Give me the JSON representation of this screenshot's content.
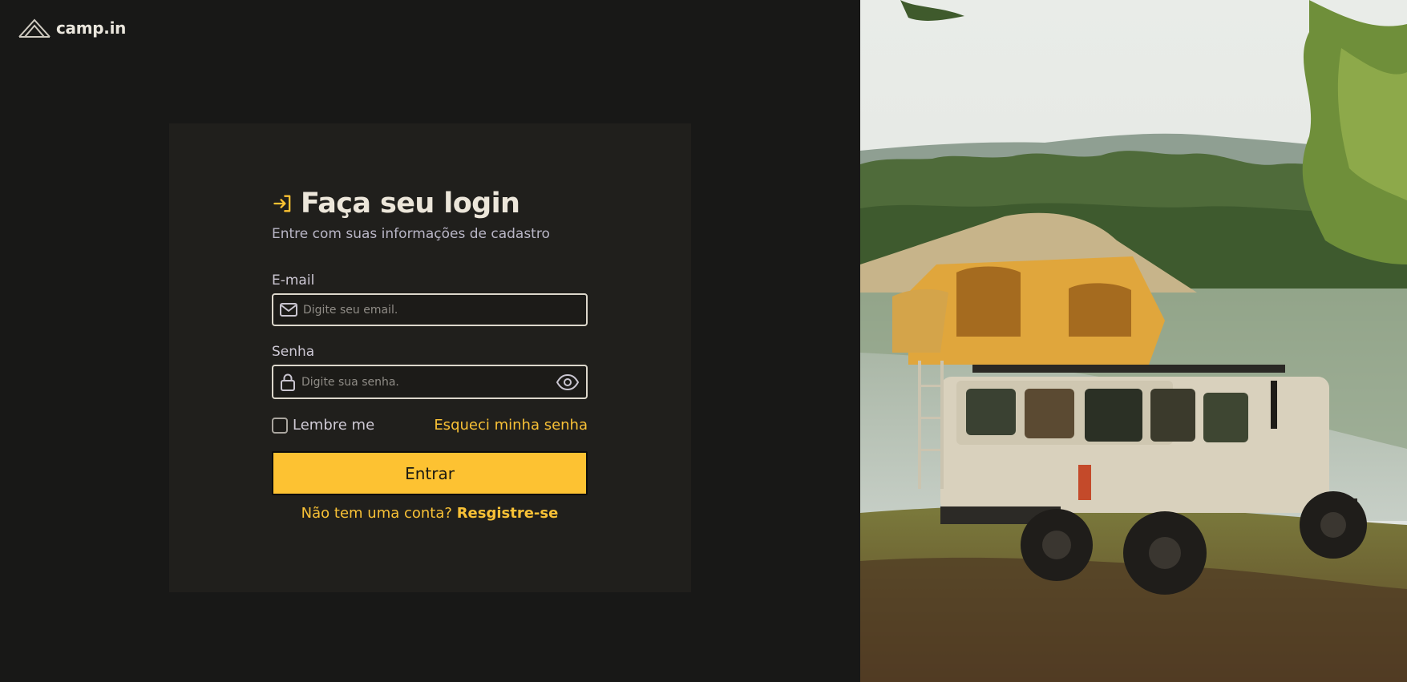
{
  "brand": {
    "name": "camp.in"
  },
  "login": {
    "title": "Faça seu login",
    "subtitle": "Entre com suas informações de cadastro",
    "email_label": "E-mail",
    "email_placeholder": "Digite seu email.",
    "email_value": "",
    "password_label": "Senha",
    "password_placeholder": "Digite sua senha.",
    "password_value": "",
    "remember_label": "Lembre me",
    "remember_checked": false,
    "forgot_label": "Esqueci minha senha",
    "submit_label": "Entrar",
    "no_account_text": "Não tem uma conta?",
    "register_label": "Resgistre-se"
  },
  "icons": {
    "logo": "tent-logo-icon",
    "title": "login-arrow-icon",
    "email": "mail-icon",
    "password": "lock-icon",
    "toggle": "eye-icon"
  },
  "colors": {
    "background": "#181817",
    "card": "#201f1c",
    "accent": "#fdc232",
    "text": "#ece6da",
    "muted": "#b9b6c6"
  }
}
